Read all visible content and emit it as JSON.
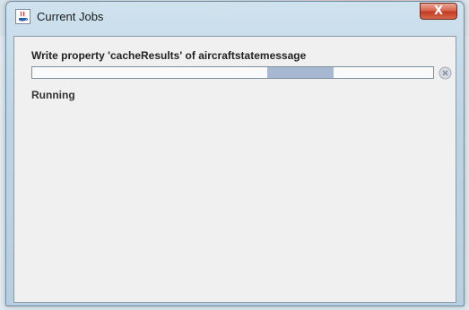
{
  "window": {
    "title": "Current Jobs",
    "close_glyph": "X"
  },
  "job": {
    "name": "Write property 'cacheResults' of aircraftstatemessage",
    "status": "Running",
    "progress_indeterminate": true,
    "cancel_icon": "cancel-icon"
  },
  "colors": {
    "progress_fill": "#a7b8d3",
    "close_button": "#c23b22"
  }
}
